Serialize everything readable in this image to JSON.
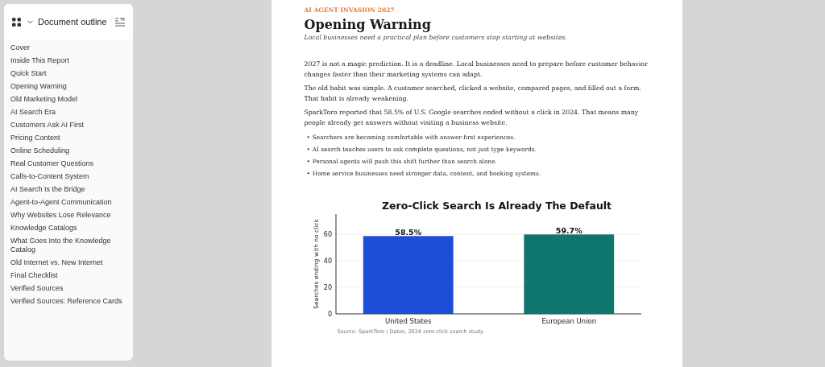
{
  "sidebar": {
    "title": "Document outline",
    "items": [
      {
        "label": "Cover"
      },
      {
        "label": "Inside This Report"
      },
      {
        "label": "Quick Start"
      },
      {
        "label": "Opening Warning"
      },
      {
        "label": "Old Marketing Model"
      },
      {
        "label": "AI Search Era"
      },
      {
        "label": "Customers Ask AI First"
      },
      {
        "label": "Pricing Content"
      },
      {
        "label": "Online Scheduling"
      },
      {
        "label": "Real Customer Questions"
      },
      {
        "label": "Calls-to-Content System"
      },
      {
        "label": "AI Search Is the Bridge"
      },
      {
        "label": "Agent-to-Agent Communication"
      },
      {
        "label": "Why Websites Lose Relevance"
      },
      {
        "label": "Knowledge Catalogs"
      },
      {
        "label": "What Goes Into the Knowledge Catalog"
      },
      {
        "label": "Old Internet vs. New Internet"
      },
      {
        "label": "Final Checklist"
      },
      {
        "label": "Verified Sources"
      },
      {
        "label": "Verified Sources: Reference Cards"
      }
    ]
  },
  "document": {
    "eyebrow": "AI AGENT INVASION 2027",
    "title": "Opening Warning",
    "subtitle": "Local businesses need a practical plan before customers stop starting at websites.",
    "paragraphs": [
      "2027 is not a magic prediction. It is a deadline. Local businesses need to prepare before customer behavior changes faster than their marketing systems can adapt.",
      "The old habit was simple. A customer searched, clicked a website, compared pages, and filled out a form. That habit is already weakening.",
      "SparkToro reported that 58.5% of U.S. Google searches ended without a click in 2024. That means many people already get answers without visiting a business website."
    ],
    "bullets": [
      "Searchers are becoming comfortable with answer-first experiences.",
      "AI search teaches users to ask complete questions, not just type keywords.",
      "Personal agents will push this shift further than search alone.",
      "Home service businesses need stronger data, content, and booking systems."
    ],
    "bullet_mark": "•",
    "figure": {
      "chart_data": {
        "type": "bar",
        "title": "Zero-Click Search Is Already The Default",
        "ylabel": "Searches ending with no click",
        "categories": [
          "United States",
          "European Union"
        ],
        "grid": true,
        "series": [
          {
            "colors": [
              "#1d4ed8",
              "#0f766e"
            ],
            "values": [
              58.5,
              59.7
            ]
          }
        ],
        "ylim": [
          0,
          75
        ],
        "yticks": [
          0,
          20,
          40,
          60
        ],
        "value_labels": [
          "58.5%",
          "59.7%"
        ]
      },
      "caption": "Source: SparkToro / Datos, 2024 zero-click search study."
    }
  }
}
